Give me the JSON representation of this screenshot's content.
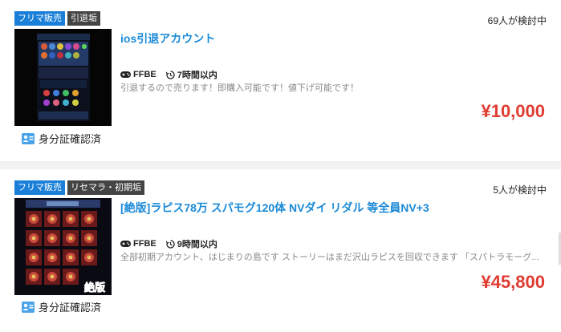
{
  "listings": [
    {
      "badges": [
        "フリマ販売",
        "引退垢"
      ],
      "watchers": "69人が検討中",
      "title": "ios引退アカウント",
      "game": "FFBE",
      "time": "7時間以内",
      "description": "引退するので売ります！即購入可能です！値下げ可能です！",
      "price": "¥10,000",
      "verification": "身分証確認済"
    },
    {
      "badges": [
        "フリマ販売",
        "リセマラ・初期垢"
      ],
      "watchers": "5人が検討中",
      "title": "[絶版]ラピス78万 スパモグ120体 NVダイ リダル 等全員NV+3",
      "game": "FFBE",
      "time": "9時間以内",
      "description": "全部初期アカウント、はじまりの島です ストーリーはまだ沢山ラピスを回収できます 「スパトラモーグ...",
      "price": "¥45,800",
      "verification": "身分証確認済",
      "thumb_overlay": "絶版"
    }
  ],
  "icons": {
    "game": "gamepad-icon",
    "time": "clock-history-icon",
    "verification": "id-card-icon"
  },
  "colors": {
    "badge_market": "#1a7fd8",
    "badge_category": "#444444",
    "title": "#1a8ad8",
    "price": "#e03c31",
    "id_icon": "#4aa3e8"
  }
}
